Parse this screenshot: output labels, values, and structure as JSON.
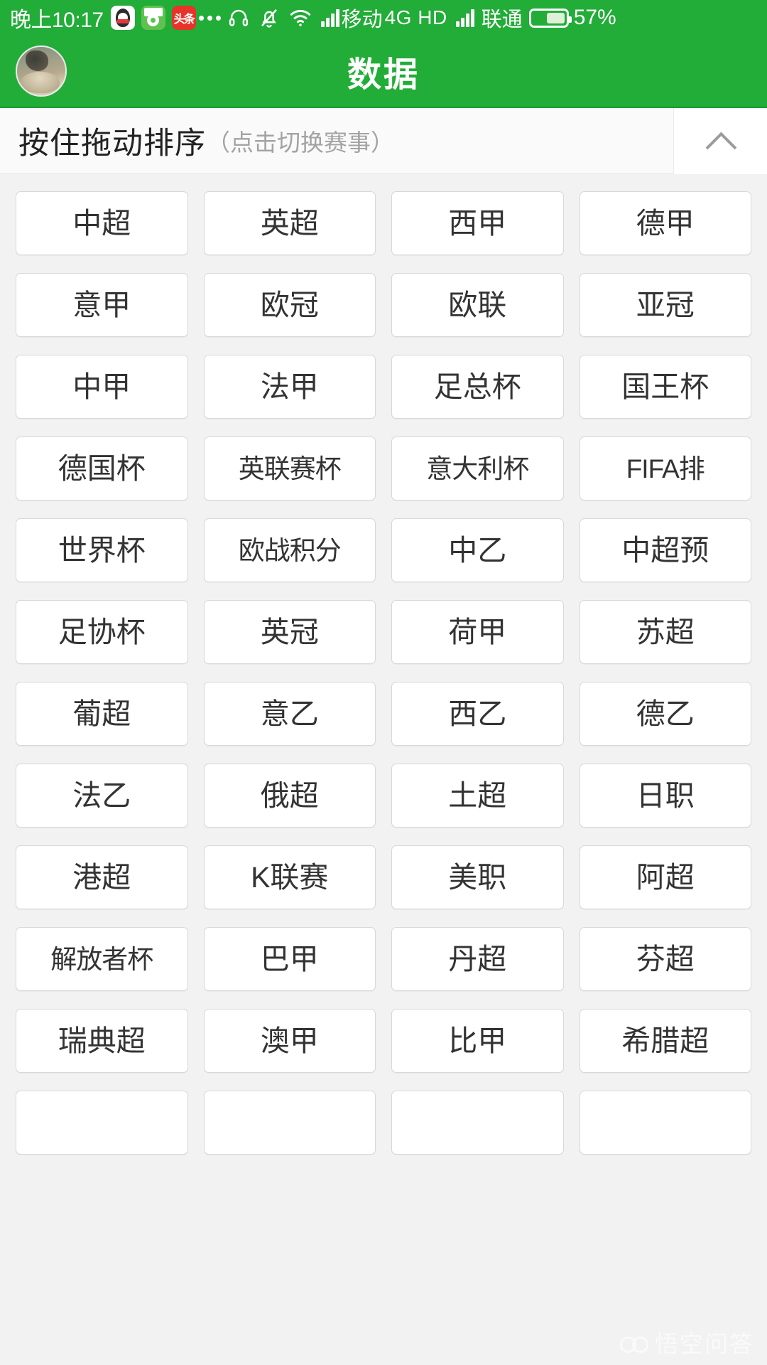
{
  "status_bar": {
    "clock": "晚上10:17",
    "app_icons": [
      {
        "name": "qq-icon",
        "label": "QQ"
      },
      {
        "name": "football-app-icon",
        "label": "球"
      },
      {
        "name": "toutiao-icon",
        "label": "头条"
      }
    ],
    "more_indicator": "•••",
    "icons": [
      "headset-icon",
      "bell-muted-icon",
      "wifi-icon",
      "signal-icon"
    ],
    "carrier_primary": "移动",
    "network_type": "4G HD",
    "carrier_secondary": "联通",
    "battery_percent": "57%",
    "battery_level": 57,
    "background_color": "#22ac38"
  },
  "app_bar": {
    "title": "数据",
    "avatar_name": "user-avatar",
    "background_color": "#22ac38"
  },
  "sort_header": {
    "main_text": "按住拖动排序",
    "sub_text": "（点击切换赛事）",
    "collapse_icon": "chevron-up-icon"
  },
  "grid": {
    "columns": 4,
    "leagues": [
      "中超",
      "英超",
      "西甲",
      "德甲",
      "意甲",
      "欧冠",
      "欧联",
      "亚冠",
      "中甲",
      "法甲",
      "足总杯",
      "国王杯",
      "德国杯",
      "英联赛杯",
      "意大利杯",
      "FIFA排",
      "世界杯",
      "欧战积分",
      "中乙",
      "中超预",
      "足协杯",
      "英冠",
      "荷甲",
      "苏超",
      "葡超",
      "意乙",
      "西乙",
      "德乙",
      "法乙",
      "俄超",
      "土超",
      "日职",
      "港超",
      "K联赛",
      "美职",
      "阿超",
      "解放者杯",
      "巴甲",
      "丹超",
      "芬超",
      "瑞典超",
      "澳甲",
      "比甲",
      "希腊超",
      "",
      "",
      "",
      ""
    ]
  },
  "watermark": {
    "text": "悟空问答",
    "icon": "wukong-logo-icon"
  },
  "colors": {
    "brand_green": "#22ac38",
    "page_background": "#f2f2f2",
    "card_background": "#ffffff",
    "card_border": "#d8d8d8",
    "text_primary": "#333333",
    "text_muted": "#a3a3a3"
  }
}
